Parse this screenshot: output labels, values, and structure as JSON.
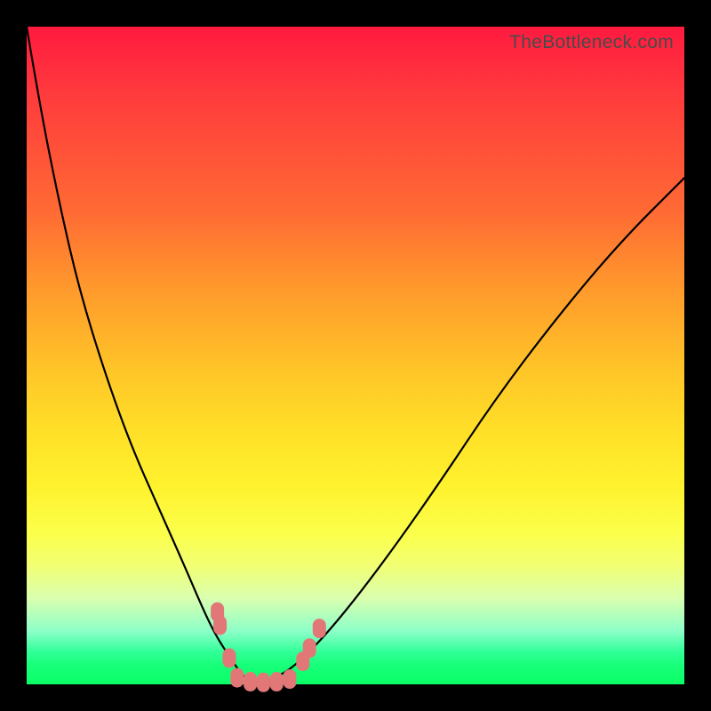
{
  "watermark": "TheBottleneck.com",
  "colors": {
    "frame": "#000000",
    "gradient_top": "#ff1a3f",
    "gradient_mid": "#ffe128",
    "gradient_bottom": "#0aff66",
    "curve": "#000000",
    "marker": "#e17877"
  },
  "chart_data": {
    "type": "line",
    "title": "",
    "xlabel": "",
    "ylabel": "",
    "xlim": [
      0,
      100
    ],
    "ylim": [
      0,
      100
    ],
    "note": "Percent axes estimated from plot area; no visible tick labels; background gradient encodes a secondary scale from red (top, high bottleneck) to green (bottom, low bottleneck); V-shaped curve with minimum near x≈35 at y≈0.",
    "series": [
      {
        "name": "left-branch",
        "x": [
          0,
          2,
          5,
          8,
          12,
          16,
          20,
          24,
          27,
          29,
          31,
          33,
          35
        ],
        "y": [
          100,
          88,
          73,
          60,
          47,
          36,
          27,
          18,
          11,
          7,
          4,
          1,
          0
        ]
      },
      {
        "name": "right-branch",
        "x": [
          35,
          38,
          41,
          45,
          50,
          56,
          63,
          71,
          80,
          90,
          100
        ],
        "y": [
          0,
          1,
          3,
          7,
          13,
          21,
          31,
          43,
          55,
          67,
          77
        ]
      }
    ],
    "markers": [
      {
        "name": "left-cluster-top-1",
        "x": 29.0,
        "y": 11.0
      },
      {
        "name": "left-cluster-top-2",
        "x": 29.4,
        "y": 9.0
      },
      {
        "name": "left-cluster-bottom-1",
        "x": 30.8,
        "y": 4.0
      },
      {
        "name": "floor-1",
        "x": 32.0,
        "y": 1.0
      },
      {
        "name": "floor-2",
        "x": 34.0,
        "y": 0.4
      },
      {
        "name": "floor-3",
        "x": 36.0,
        "y": 0.3
      },
      {
        "name": "floor-4",
        "x": 38.0,
        "y": 0.4
      },
      {
        "name": "floor-5",
        "x": 40.0,
        "y": 0.8
      },
      {
        "name": "right-cluster-1",
        "x": 42.0,
        "y": 3.5
      },
      {
        "name": "right-cluster-2",
        "x": 43.0,
        "y": 5.5
      },
      {
        "name": "right-cluster-3",
        "x": 44.5,
        "y": 8.5
      }
    ]
  }
}
